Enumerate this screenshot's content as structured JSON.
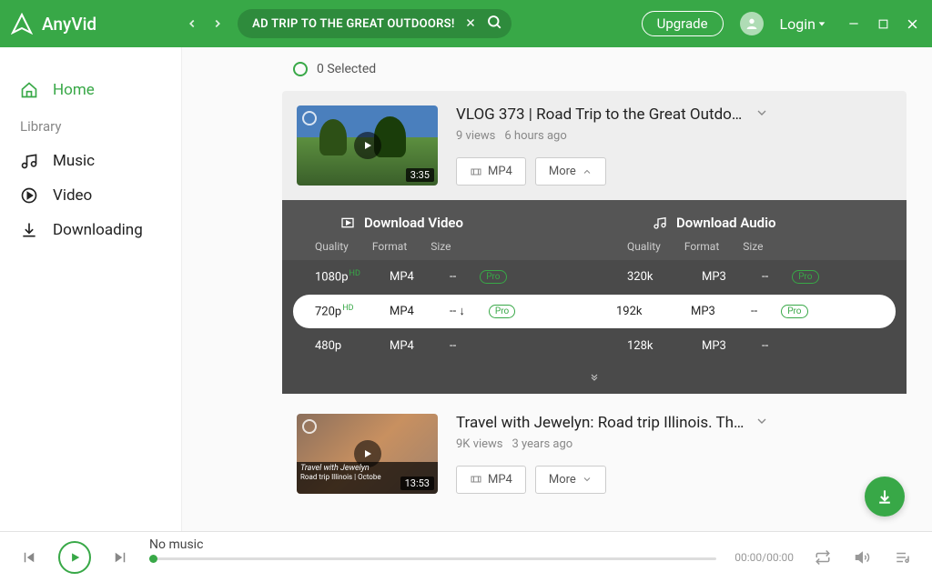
{
  "header": {
    "app_name": "AnyVid",
    "search_text": "AD TRIP TO THE GREAT OUTDOORS!",
    "upgrade": "Upgrade",
    "login": "Login"
  },
  "sidebar": {
    "home": "Home",
    "library_label": "Library",
    "music": "Music",
    "video": "Video",
    "downloading": "Downloading"
  },
  "selection": {
    "text": "0 Selected"
  },
  "results": [
    {
      "title": "VLOG 373 | Road Trip to the Great Outdoo...",
      "views": "9 views",
      "age": "6 hours ago",
      "duration": "3:35",
      "mp4_btn": "MP4",
      "more_btn": "More"
    },
    {
      "title": "Travel with Jewelyn: Road trip Illinois. The g...",
      "views": "9K views",
      "age": "3 years ago",
      "duration": "13:53",
      "overlay_line1": "Travel with Jewelyn",
      "overlay_line2": "Road trip Illinois | Octobe",
      "mp4_btn": "MP4",
      "more_btn": "More"
    }
  ],
  "dl": {
    "video_head": "Download Video",
    "audio_head": "Download Audio",
    "quality": "Quality",
    "format": "Format",
    "size": "Size",
    "video_rows": [
      {
        "q": "1080p",
        "hd": "HD",
        "f": "MP4",
        "s": "--",
        "pro": true,
        "active": false
      },
      {
        "q": "720p",
        "hd": "HD",
        "f": "MP4",
        "s": "-- ↓",
        "pro": true,
        "active": true
      },
      {
        "q": "480p",
        "hd": "",
        "f": "MP4",
        "s": "--",
        "pro": false,
        "active": false
      }
    ],
    "audio_rows": [
      {
        "q": "320k",
        "f": "MP3",
        "s": "--",
        "pro": true
      },
      {
        "q": "192k",
        "f": "MP3",
        "s": "--",
        "pro": true
      },
      {
        "q": "128k",
        "f": "MP3",
        "s": "--",
        "pro": false
      }
    ]
  },
  "player": {
    "title": "No music",
    "time": "00:00/00:00"
  }
}
